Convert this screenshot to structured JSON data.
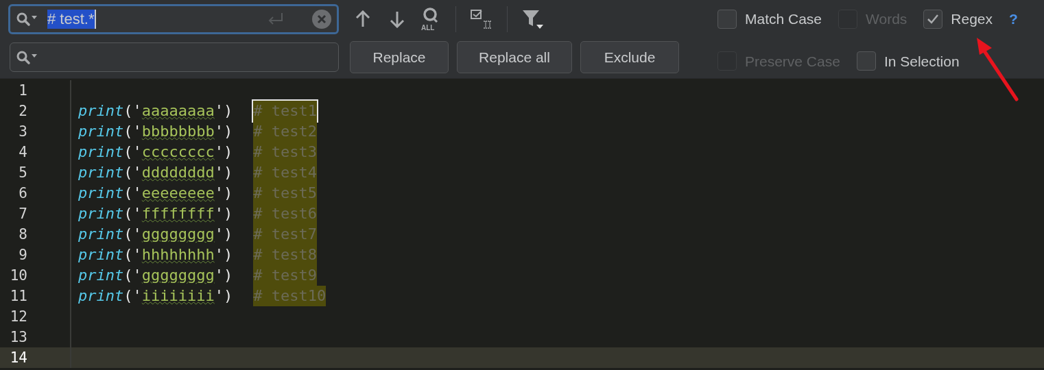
{
  "find_field": {
    "value": "# test.*"
  },
  "toolbar": {
    "find_all_label": "ALL"
  },
  "buttons": [
    "Replace",
    "Replace all",
    "Exclude"
  ],
  "options_row_1": [
    {
      "label": "Match Case",
      "checked": false,
      "disabled": false
    },
    {
      "label": "Words",
      "checked": false,
      "disabled": true
    },
    {
      "label": "Regex",
      "checked": true,
      "disabled": false
    }
  ],
  "help": "?",
  "options_row_2": [
    {
      "label": "Preserve Case",
      "checked": false,
      "disabled": true
    },
    {
      "label": "In Selection",
      "checked": false,
      "disabled": false
    }
  ],
  "lines": [
    {
      "number": "1",
      "current": false
    },
    {
      "number": "2",
      "current": false,
      "fn": "print",
      "open": "('",
      "arg": "aaaaaaaa",
      "close": "')",
      "comment": "# test1",
      "match": true,
      "selected": true
    },
    {
      "number": "3",
      "current": false,
      "fn": "print",
      "open": "('",
      "arg": "bbbbbbbb",
      "close": "')",
      "comment": "# test2",
      "match": true,
      "selected": false
    },
    {
      "number": "4",
      "current": false,
      "fn": "print",
      "open": "('",
      "arg": "cccccccc",
      "close": "')",
      "comment": "# test3",
      "match": true,
      "selected": false
    },
    {
      "number": "5",
      "current": false,
      "fn": "print",
      "open": "('",
      "arg": "dddddddd",
      "close": "')",
      "comment": "# test4",
      "match": true,
      "selected": false
    },
    {
      "number": "6",
      "current": false,
      "fn": "print",
      "open": "('",
      "arg": "eeeeeeee",
      "close": "')",
      "comment": "# test5",
      "match": true,
      "selected": false
    },
    {
      "number": "7",
      "current": false,
      "fn": "print",
      "open": "('",
      "arg": "ffffffff",
      "close": "')",
      "comment": "# test6",
      "match": true,
      "selected": false
    },
    {
      "number": "8",
      "current": false,
      "fn": "print",
      "open": "('",
      "arg": "gggggggg",
      "close": "')",
      "comment": "# test7",
      "match": true,
      "selected": false
    },
    {
      "number": "9",
      "current": false,
      "fn": "print",
      "open": "('",
      "arg": "hhhhhhhh",
      "close": "')",
      "comment": "# test8",
      "match": true,
      "selected": false
    },
    {
      "number": "10",
      "current": false,
      "fn": "print",
      "open": "('",
      "arg": "gggggggg",
      "close": "')",
      "comment": "# test9",
      "match": true,
      "selected": false
    },
    {
      "number": "11",
      "current": false,
      "fn": "print",
      "open": "('",
      "arg": "iiiiiiii",
      "close": "')",
      "comment": "# test10",
      "match": true,
      "selected": false
    },
    {
      "number": "12",
      "current": false
    },
    {
      "number": "13",
      "current": false
    },
    {
      "number": "14",
      "current": true
    }
  ]
}
